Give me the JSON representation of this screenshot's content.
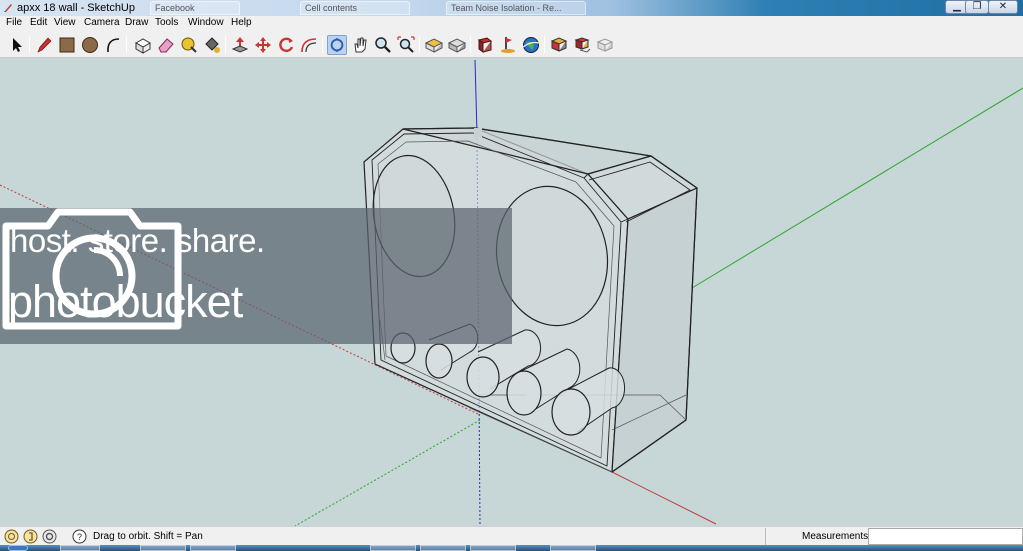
{
  "window": {
    "title": "apxx 18 wall - SketchUp",
    "background_tabs": [
      "Facebook",
      "Cell contents",
      "Team Noise Isolation - Re..."
    ]
  },
  "window_controls": [
    "minimize",
    "maximize",
    "close"
  ],
  "menu": [
    "File",
    "Edit",
    "View",
    "Camera",
    "Draw",
    "Tools",
    "Window",
    "Help"
  ],
  "toolbar": {
    "groups": [
      [
        "select-icon"
      ],
      [
        "pencil-icon",
        "rectangle-icon",
        "circle-icon",
        "arc-icon"
      ],
      [
        "make-component-icon",
        "eraser-icon",
        "tape-measure-icon",
        "paint-bucket-icon"
      ],
      [
        "push-pull-icon",
        "move-icon",
        "rotate-icon",
        "offset-icon"
      ],
      [
        "orbit-icon",
        "pan-icon",
        "zoom-icon",
        "zoom-extents-icon"
      ],
      [
        "top-view-icon",
        "iso-view-icon"
      ],
      [
        "get-models-icon",
        "add-location-icon",
        "google-earth-icon"
      ],
      [
        "component-icon",
        "shadow-icon",
        "fog-icon"
      ]
    ],
    "active": "orbit-icon"
  },
  "watermark": {
    "line1": "host. store. share.",
    "line2": "photobucket"
  },
  "axis_colors": {
    "red": "#c43c3c",
    "green": "#2aa82a",
    "blue": "#2a2ac8"
  },
  "status": {
    "icons": [
      "geo-location-icon",
      "credits-icon",
      "user-icon"
    ],
    "help_icon": "help-icon",
    "text": "Drag to orbit.  Shift = Pan",
    "measurements_label": "Measurements",
    "measurements_value": ""
  }
}
